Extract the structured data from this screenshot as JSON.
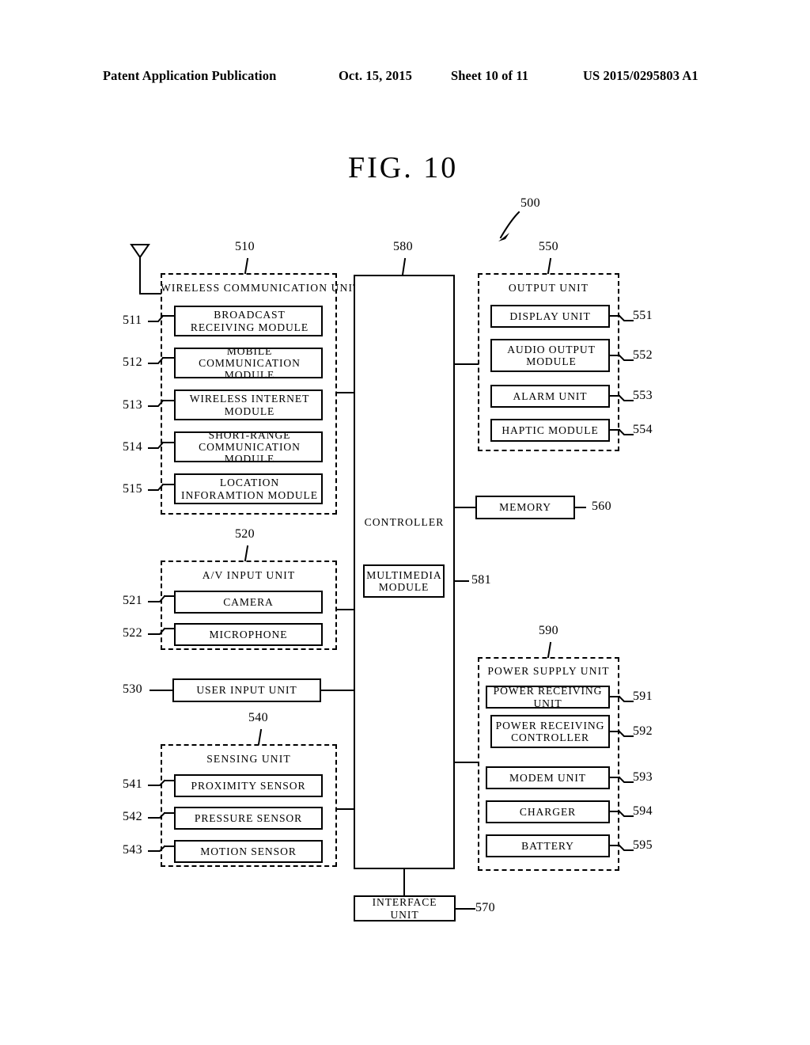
{
  "header": {
    "publication": "Patent Application Publication",
    "date": "Oct. 15, 2015",
    "sheet": "Sheet 10 of 11",
    "number": "US 2015/0295803 A1"
  },
  "figure": {
    "title": "FIG.  10",
    "device_ref": "500"
  },
  "blocks": {
    "wireless_communication_unit": {
      "label": "WIRELESS COMMUNICATION UNIT",
      "ref": "510",
      "items": [
        {
          "label": "BROADCAST RECEIVING MODULE",
          "ref": "511"
        },
        {
          "label": "MOBILE COMMUNICATION MODULE",
          "ref": "512"
        },
        {
          "label": "WIRELESS INTERNET MODULE",
          "ref": "513"
        },
        {
          "label": "SHORT-RANGE COMMUNICATION MODULE",
          "ref": "514"
        },
        {
          "label": "LOCATION INFORAMTION MODULE",
          "ref": "515"
        }
      ]
    },
    "av_input_unit": {
      "label": "A/V INPUT UNIT",
      "ref": "520",
      "items": [
        {
          "label": "CAMERA",
          "ref": "521"
        },
        {
          "label": "MICROPHONE",
          "ref": "522"
        }
      ]
    },
    "user_input_unit": {
      "label": "USER INPUT UNIT",
      "ref": "530"
    },
    "sensing_unit": {
      "label": "SENSING UNIT",
      "ref": "540",
      "items": [
        {
          "label": "PROXIMITY SENSOR",
          "ref": "541"
        },
        {
          "label": "PRESSURE SENSOR",
          "ref": "542"
        },
        {
          "label": "MOTION SENSOR",
          "ref": "543"
        }
      ]
    },
    "output_unit": {
      "label": "OUTPUT UNIT",
      "ref": "550",
      "items": [
        {
          "label": "DISPLAY UNIT",
          "ref": "551"
        },
        {
          "label": "AUDIO OUTPUT MODULE",
          "ref": "552"
        },
        {
          "label": "ALARM UNIT",
          "ref": "553"
        },
        {
          "label": "HAPTIC MODULE",
          "ref": "554"
        }
      ]
    },
    "memory": {
      "label": "MEMORY",
      "ref": "560"
    },
    "interface_unit": {
      "label": "INTERFACE UNIT",
      "ref": "570"
    },
    "controller": {
      "label": "CONTROLLER",
      "ref": "580",
      "multimedia_module": {
        "label": "MULTIMEDIA MODULE",
        "ref": "581"
      }
    },
    "power_supply_unit": {
      "label": "POWER SUPPLY UNIT",
      "ref": "590",
      "items": [
        {
          "label": "POWER RECEIVING UNIT",
          "ref": "591"
        },
        {
          "label": "POWER RECEIVING CONTROLLER",
          "ref": "592"
        },
        {
          "label": "MODEM UNIT",
          "ref": "593"
        },
        {
          "label": "CHARGER",
          "ref": "594"
        },
        {
          "label": "BATTERY",
          "ref": "595"
        }
      ]
    },
    "antenna": {
      "icon": "antenna-icon"
    }
  }
}
